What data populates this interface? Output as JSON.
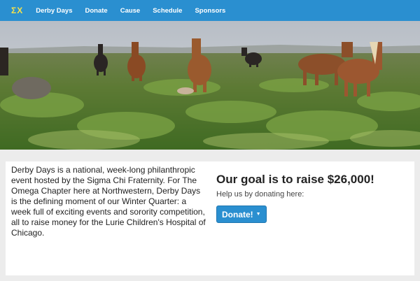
{
  "navbar": {
    "brand": "ΣΧ",
    "links": [
      "Derby Days",
      "Donate",
      "Cause",
      "Schedule",
      "Sponsors"
    ]
  },
  "hero": {
    "image": "horses grazing in grassy field"
  },
  "about": {
    "text": "Derby Days is a national, week-long philanthropic event hosted by the Sigma Chi Fraternity. For The Omega Chapter here at Northwestern, Derby Days is the defining moment of our Winter Quarter: a week full of exciting events and sorority competition, all to raise money for the Lurie Children's Hospital of Chicago."
  },
  "donation": {
    "goal": "Our goal is to raise $26,000!",
    "prompt": "Help us by donating here:",
    "button_label": "Donate!",
    "button_icon": "caret-down-icon"
  },
  "colors": {
    "navbar": "#2a8fd0",
    "brand": "#f7e24a",
    "button": "#2a8fd0",
    "page_background": "#ececec"
  }
}
